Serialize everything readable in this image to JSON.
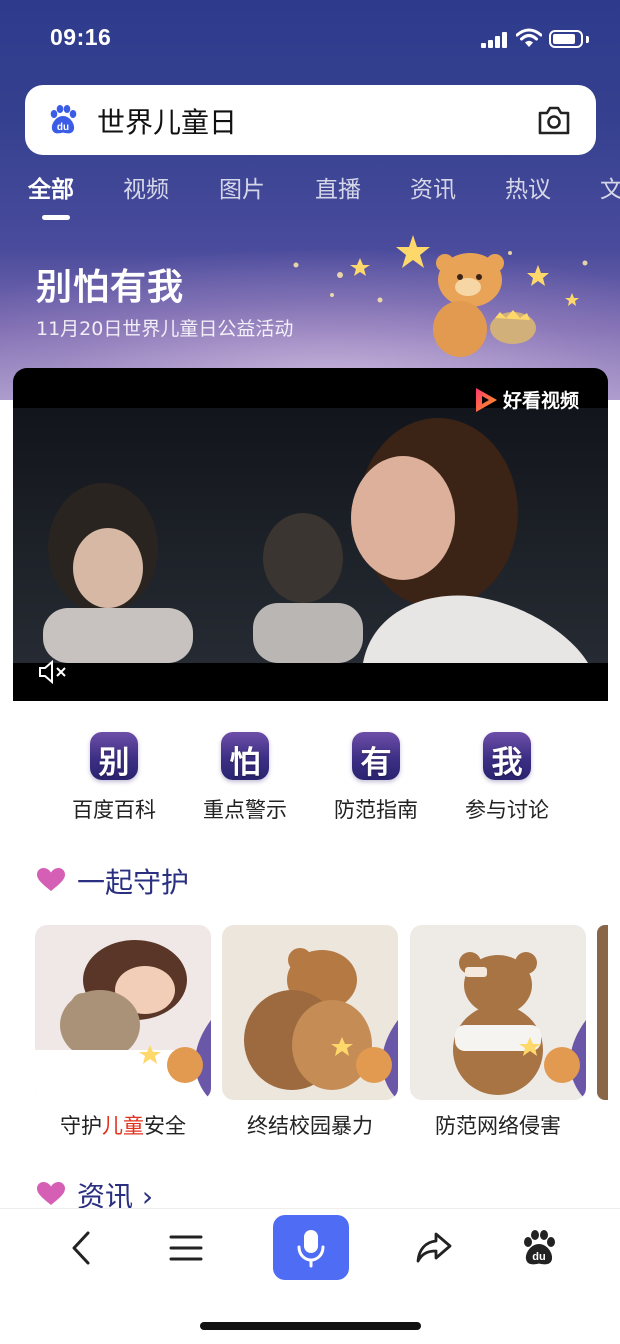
{
  "status_bar": {
    "time": "09:16"
  },
  "search": {
    "query": "世界儿童日"
  },
  "tabs": [
    {
      "label": "全部",
      "active": true
    },
    {
      "label": "视频"
    },
    {
      "label": "图片"
    },
    {
      "label": "直播"
    },
    {
      "label": "资讯"
    },
    {
      "label": "热议"
    },
    {
      "label": "文"
    }
  ],
  "banner": {
    "title": "别怕有我",
    "subtitle": "11月20日世界儿童日公益活动"
  },
  "video": {
    "brand": "好看视频",
    "muted": true
  },
  "quick_links": [
    {
      "glyph": "别",
      "label": "百度百科"
    },
    {
      "glyph": "怕",
      "label": "重点警示"
    },
    {
      "glyph": "有",
      "label": "防范指南"
    },
    {
      "glyph": "我",
      "label": "参与讨论"
    }
  ],
  "sections": {
    "together": {
      "title": "一起守护"
    },
    "news": {
      "title": "资讯 ›"
    }
  },
  "cards": [
    {
      "label_pre": "守护",
      "label_hl": "儿童",
      "label_post": "安全"
    },
    {
      "label_pre": "终结校园暴力",
      "label_hl": "",
      "label_post": ""
    },
    {
      "label_pre": "防范网络侵害",
      "label_hl": "",
      "label_post": ""
    }
  ],
  "colors": {
    "accent": "#4e6cf4",
    "highlight": "#e0321e",
    "section_title": "#2a2f80",
    "heart": "#d65fb6"
  },
  "icons": {
    "bottom_nav": [
      "back-icon",
      "menu-icon",
      "mic-icon",
      "share-icon",
      "baidu-paw-icon"
    ]
  }
}
